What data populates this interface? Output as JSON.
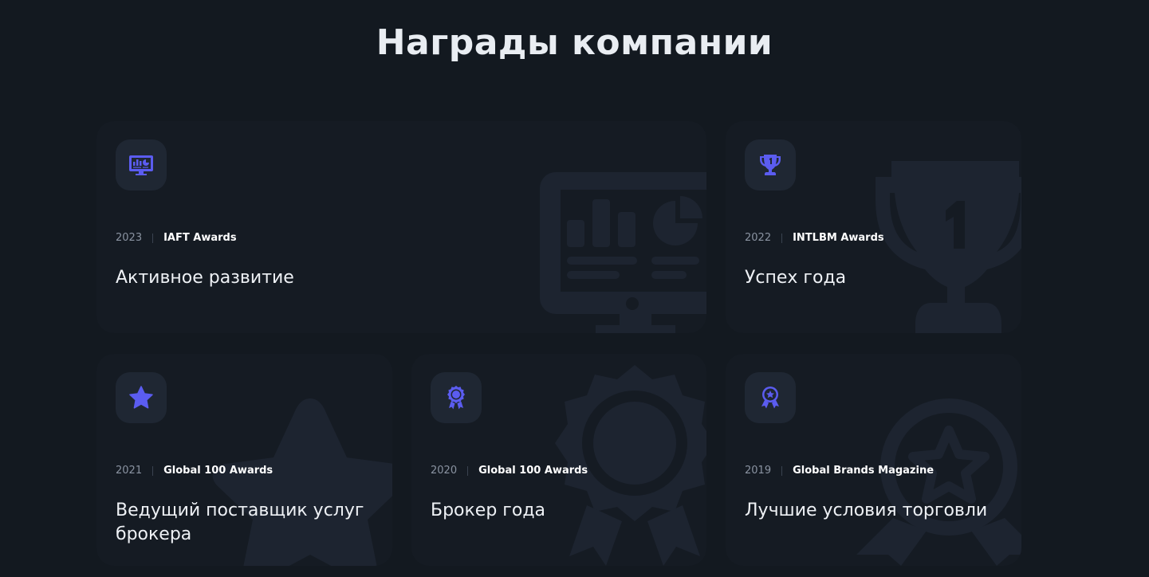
{
  "page_title": "Награды компании",
  "colors": {
    "background": "#131920",
    "card": "#151b23",
    "icon_box": "#1f2733",
    "accent": "#5b5cf0",
    "bg_art": "#1d2430"
  },
  "awards": [
    {
      "year": "2023",
      "org": "IAFT Awards",
      "title": "Активное развитие",
      "icon": "monitor-chart-icon"
    },
    {
      "year": "2022",
      "org": "INTLBM Awards",
      "title": "Успех года",
      "icon": "trophy-icon"
    },
    {
      "year": "2021",
      "org": "Global 100 Awards",
      "title": "Ведущий поставщик услуг брокера",
      "icon": "star-icon"
    },
    {
      "year": "2020",
      "org": "Global 100 Awards",
      "title": "Брокер года",
      "icon": "medal-icon"
    },
    {
      "year": "2019",
      "org": "Global Brands Magazine",
      "title": "Лучшие условия торговли",
      "icon": "star-medal-icon"
    }
  ]
}
